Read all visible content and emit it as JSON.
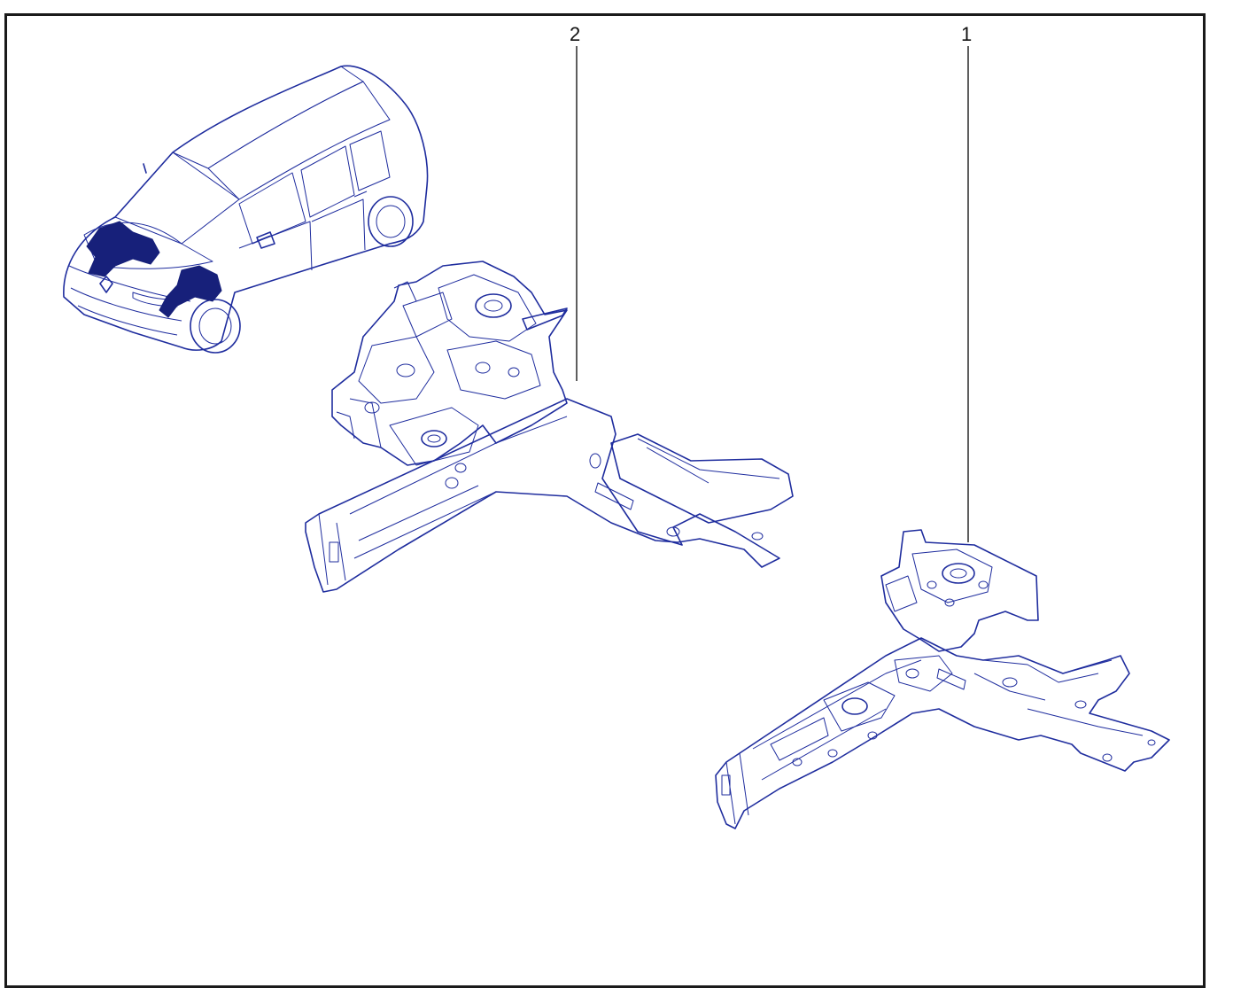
{
  "callouts": [
    {
      "label": "2"
    },
    {
      "label": "1"
    }
  ],
  "colors": {
    "line": "#1f2d9e",
    "highlight": "#17207a",
    "frame": "#1a1a1a"
  }
}
